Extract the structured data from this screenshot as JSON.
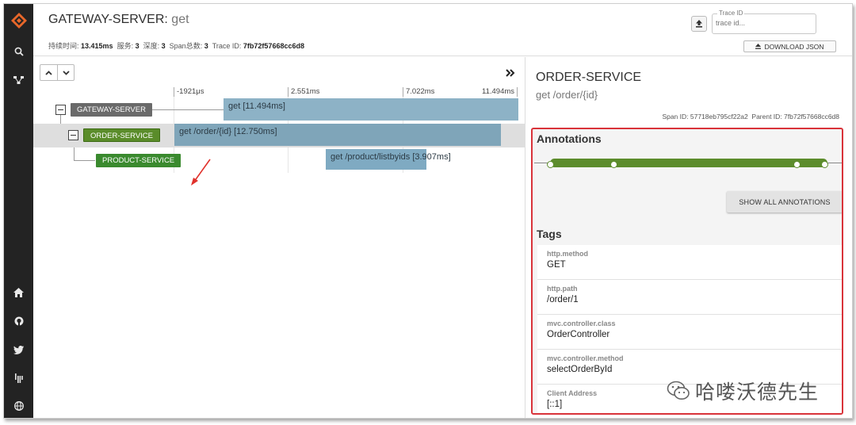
{
  "header": {
    "service_name": "GATEWAY-SERVER:",
    "span_name": " get",
    "meta": {
      "duration_label": "持续时间: ",
      "duration_value": "13.415ms",
      "services_label": "服务: ",
      "services_value": "3",
      "depth_label": "深度: ",
      "depth_value": "3",
      "span_total_label": "Span总数: ",
      "span_total_value": "3",
      "trace_id_label": "Trace ID: ",
      "trace_id_value": "7fb72f57668cc6d8"
    },
    "trace_search": {
      "label": "Trace ID",
      "placeholder": "trace id..."
    },
    "download_label": "DOWNLOAD JSON"
  },
  "timeline": {
    "ticks": [
      "-1921μs",
      "2.551ms",
      "7.022ms",
      "11.494ms"
    ],
    "rows": [
      {
        "service": "GATEWAY-SERVER",
        "span": "get [11.494ms]"
      },
      {
        "service": "ORDER-SERVICE",
        "span": "get /order/{id} [12.750ms]"
      },
      {
        "service": "PRODUCT-SERVICE",
        "span": "get /product/listbyids [3.907ms]"
      }
    ]
  },
  "detail": {
    "service_name": "ORDER-SERVICE",
    "span_name": "get /order/{id}",
    "span_id_label": "Span ID: ",
    "span_id": "57718eb795cf22a2",
    "parent_id_label": "Parent ID: ",
    "parent_id": "7fb72f57668cc6d8",
    "annotations_title": "Annotations",
    "show_all_label": "SHOW ALL ANNOTATIONS",
    "tags_title": "Tags",
    "tags": [
      {
        "key": "http.method",
        "value": "GET"
      },
      {
        "key": "http.path",
        "value": "/order/1"
      },
      {
        "key": "mvc.controller.class",
        "value": "OrderController"
      },
      {
        "key": "mvc.controller.method",
        "value": "selectOrderById"
      },
      {
        "key": "Client Address",
        "value": "[::1]"
      }
    ]
  },
  "watermark": "哈喽沃德先生",
  "colors": {
    "accent_orange": "#e8672a",
    "annotation_green": "#5c8c2c",
    "highlight_red": "#d9333a"
  },
  "icons": [
    "zipkin-logo-icon",
    "search-icon",
    "dependencies-icon",
    "home-icon",
    "github-icon",
    "twitter-icon",
    "gitter-icon",
    "globe-icon",
    "upload-icon",
    "download-icon",
    "chevron-up-icon",
    "chevron-down-icon",
    "double-chevron-right-icon"
  ]
}
